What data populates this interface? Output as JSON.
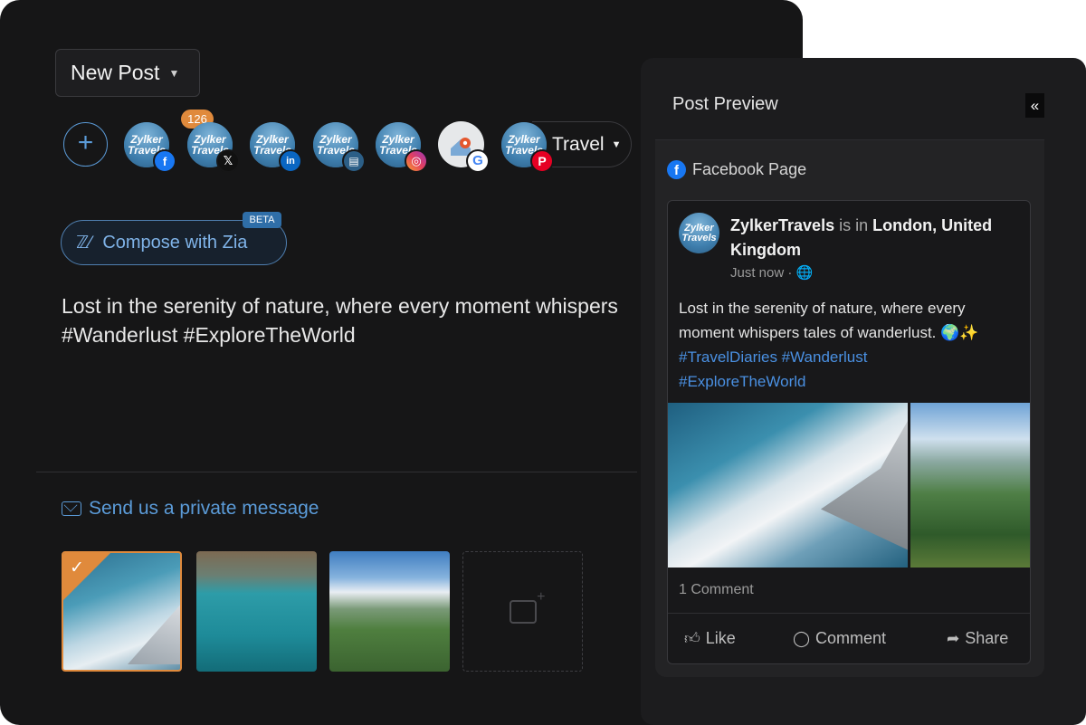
{
  "composer": {
    "new_post_label": "New Post",
    "add_icon": "plus-icon",
    "accounts": [
      {
        "logo_text": "Zylker Travels",
        "network": "facebook",
        "badge": ""
      },
      {
        "logo_text": "Zylker Travels",
        "network": "x",
        "badge": "126"
      },
      {
        "logo_text": "Zylker Travels",
        "network": "linkedin",
        "badge": ""
      },
      {
        "logo_text": "Zylker Travels",
        "network": "tiktok-shop",
        "badge": ""
      },
      {
        "logo_text": "Zylker Travels",
        "network": "instagram",
        "badge": ""
      },
      {
        "logo_text": "",
        "network": "google-business",
        "badge": ""
      },
      {
        "logo_text": "Zylker Travels",
        "network": "pinterest",
        "badge": ""
      }
    ],
    "group_label": "Travel",
    "compose_zia_label": "Compose with Zia",
    "beta_label": "BETA",
    "post_text_line1": "Lost in the serenity of nature, where every moment whispers",
    "post_text_line2": "#Wanderlust #ExploreTheWorld",
    "private_message_label": "Send us a private message",
    "media": [
      {
        "name": "airplane-wing-clouds",
        "selected": true
      },
      {
        "name": "turquoise-boats",
        "selected": false
      },
      {
        "name": "mountain-hiker",
        "selected": false
      }
    ],
    "add_media_icon": "add-image-icon"
  },
  "preview": {
    "title": "Post Preview",
    "collapse_icon": "double-chevron-left-icon",
    "network_label": "Facebook Page",
    "author": "ZylkerTravels",
    "is_in": "is in",
    "location": "London, United Kingdom",
    "time": "Just now",
    "text": "Lost in the serenity of nature, where every moment whispers tales of wanderlust. 🌍✨",
    "tags_line1": "#TravelDiaries #Wanderlust",
    "tags_line2": "#ExploreTheWorld",
    "comment_count": "1 Comment",
    "like_label": "Like",
    "comment_label": "Comment",
    "share_label": "Share"
  },
  "colors": {
    "accent": "#5b9bd8",
    "selected": "#e08a3c",
    "facebook": "#1877f2"
  }
}
